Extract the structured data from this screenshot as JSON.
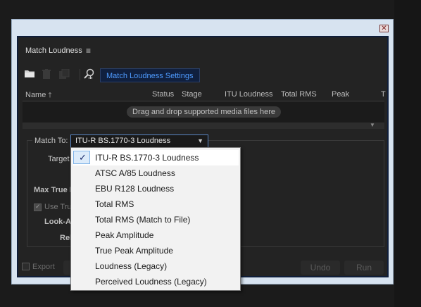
{
  "panel": {
    "title": "Match Loudness",
    "menu_icon": "hamburger-icon",
    "window_close_label": "✕"
  },
  "toolbar": {
    "open_icon": "folder-icon",
    "delete_icon": "trash-icon",
    "duplicate_icon": "duplicate-icon",
    "analyze_icon": "analyze-icon",
    "settings_label": "Match Loudness Settings"
  },
  "file_list": {
    "columns": [
      "Name",
      "Status",
      "Stage",
      "ITU Loudness",
      "Total RMS",
      "Peak",
      "T"
    ],
    "sort_icon": "sort-ascending-icon",
    "drop_hint": "Drag and drop supported media files here"
  },
  "settings": {
    "match_to_label": "Match To:",
    "match_to_value": "ITU-R BS.1770-3 Loudness",
    "target_label": "Target",
    "max_true_peak_label": "Max True P",
    "use_true_label": "Use True",
    "look_ahead_label": "Look-Al",
    "release_label": "Rel"
  },
  "footer": {
    "export_label": "Export",
    "undo_label": "Undo",
    "run_label": "Run"
  },
  "dropdown": {
    "selected_index": 0,
    "check_glyph": "✓",
    "items": [
      "ITU-R BS.1770-3 Loudness",
      "ATSC A/85 Loudness",
      "EBU R128 Loudness",
      "Total RMS",
      "Total RMS (Match to File)",
      "Peak Amplitude",
      "True Peak Amplitude",
      "Loudness (Legacy)",
      "Perceived Loudness (Legacy)"
    ]
  },
  "colors": {
    "panel_bg": "#232323",
    "accent_blue": "#4e9bff",
    "menu_bg": "#f2f2f2"
  }
}
